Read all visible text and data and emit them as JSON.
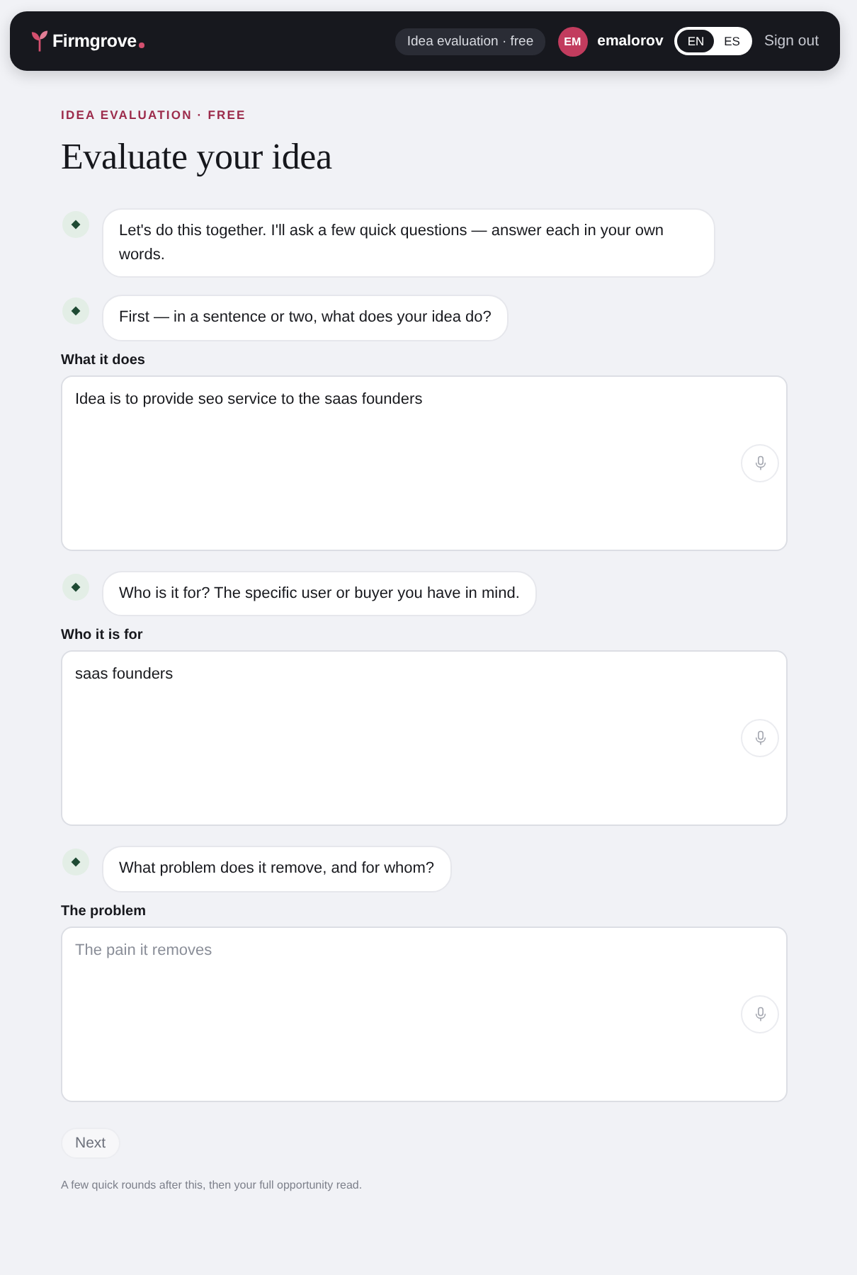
{
  "header": {
    "brand": "Firmgrove",
    "badge": "Idea evaluation · free",
    "user": {
      "initials": "EM",
      "name": "emalorov"
    },
    "languages": [
      {
        "label": "EN",
        "selected": true
      },
      {
        "label": "ES",
        "selected": false
      }
    ],
    "sign_out": "Sign out"
  },
  "eyebrow": "IDEA EVALUATION · FREE",
  "title": "Evaluate your idea",
  "conversation": [
    {
      "kind": "message",
      "text": "Let's do this together. I'll ask a few quick questions — answer each in your own words."
    },
    {
      "kind": "message",
      "text": "First — in a sentence or two, what does your idea do?"
    },
    {
      "kind": "answer",
      "label": "What it does",
      "value": "Idea is to provide seo service to the saas founders"
    },
    {
      "kind": "message",
      "text": "Who is it for? The specific user or buyer you have in mind."
    },
    {
      "kind": "answer",
      "label": "Who it is for",
      "value": "saas founders"
    },
    {
      "kind": "message",
      "text": "What problem does it remove, and for whom?"
    },
    {
      "kind": "answer",
      "label": "The problem",
      "placeholder": "The pain it removes"
    }
  ],
  "next_button": {
    "label": "Next",
    "disabled": true
  },
  "note": "A few quick rounds after this, then your full opportunity read."
}
